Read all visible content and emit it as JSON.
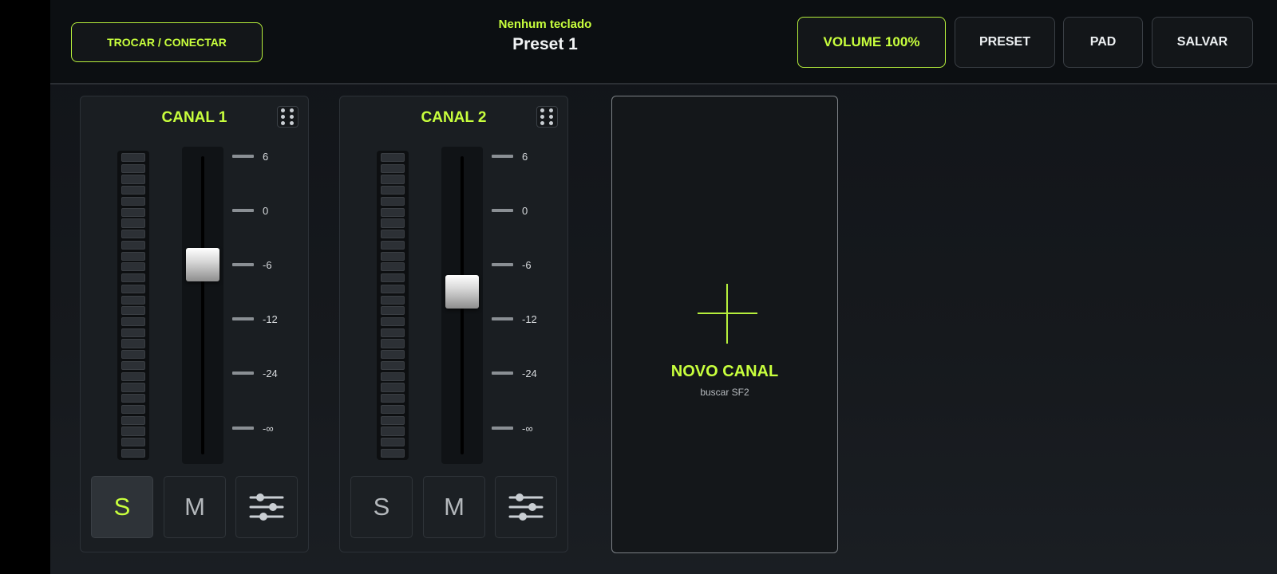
{
  "topbar": {
    "connect_label": "TROCAR / CONECTAR",
    "keyboard_status": "Nenhum teclado",
    "preset_name": "Preset 1",
    "volume_label": "VOLUME 100%",
    "preset_label": "PRESET",
    "pad_label": "PAD",
    "save_label": "SALVAR"
  },
  "scale_labels": [
    "6",
    "0",
    "-6",
    "-12",
    "-24",
    "-∞"
  ],
  "channels": [
    {
      "name": "CANAL 1",
      "fader_db": -6,
      "solo_active": true,
      "solo_label": "S",
      "mute_label": "M"
    },
    {
      "name": "CANAL 2",
      "fader_db": -9,
      "solo_active": false,
      "solo_label": "S",
      "mute_label": "M"
    }
  ],
  "new_channel": {
    "title": "NOVO CANAL",
    "subtitle": "buscar SF2"
  },
  "colors": {
    "accent": "#c8ff3d",
    "background": "#14171a",
    "panel": "#1a1e22"
  },
  "icons": {
    "drag_handle": "drag-handle-icon",
    "eq": "sliders-icon",
    "add": "plus-icon"
  }
}
